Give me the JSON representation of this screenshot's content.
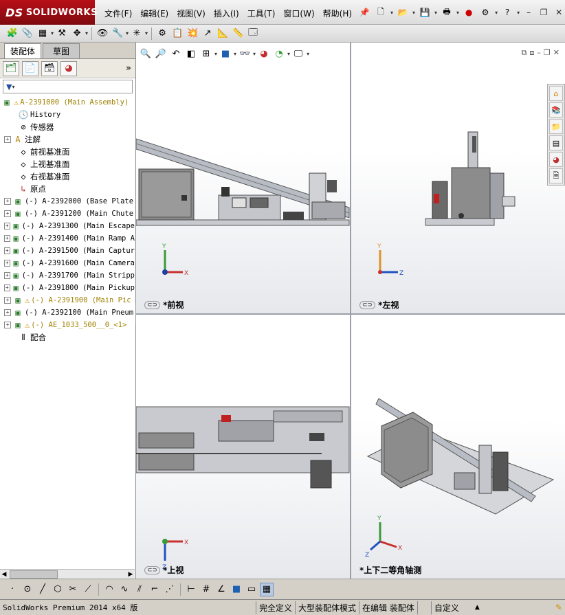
{
  "app": {
    "logo_ds": "DS",
    "logo_text": "SOLIDWORKS",
    "accent_color": "#9b0d13"
  },
  "menu": [
    "文件(F)",
    "编辑(E)",
    "视图(V)",
    "插入(I)",
    "工具(T)",
    "窗口(W)",
    "帮助(H)"
  ],
  "left_panel": {
    "tabs": [
      "装配体",
      "草图"
    ],
    "collapse_glyph": "»",
    "tree": {
      "root": "A-2391000  (Main Assembly)",
      "items": [
        {
          "label": "History"
        },
        {
          "label": "传感器"
        },
        {
          "label": "注解"
        },
        {
          "label": "前视基准面"
        },
        {
          "label": "上视基准面"
        },
        {
          "label": "右视基准面"
        },
        {
          "label": "原点"
        },
        {
          "label": "(-) A-2392000  (Base Plate"
        },
        {
          "label": "(-) A-2391200  (Main Chute"
        },
        {
          "label": "(-) A-2391300  (Main Escape"
        },
        {
          "label": "(-) A-2391400  (Main Ramp A"
        },
        {
          "label": "(-) A-2391500  (Main Captur"
        },
        {
          "label": "(-) A-2391600  (Main Camera"
        },
        {
          "label": "(-) A-2391700  (Main Stripp"
        },
        {
          "label": "(-) A-2391800  (Main Pickup"
        },
        {
          "label": "(-) A-2391900  (Main Pic"
        },
        {
          "label": "(-) A-2392100  (Main Pneum"
        },
        {
          "label": "(-) AE_1033_500__0_<1>"
        },
        {
          "label": "配合"
        }
      ]
    }
  },
  "viewports": {
    "front": {
      "label": "*前视"
    },
    "left": {
      "label": "*左视"
    },
    "top": {
      "label": "*上视"
    },
    "iso": {
      "label": "*上下二等角轴测"
    }
  },
  "axes": {
    "x": "X",
    "y": "Y",
    "z": "Z"
  },
  "status": {
    "product": "SolidWorks Premium 2014 x64 版",
    "defined": "完全定义",
    "mode": "大型装配体模式",
    "editing": "在编辑 装配体",
    "units": "自定义"
  }
}
